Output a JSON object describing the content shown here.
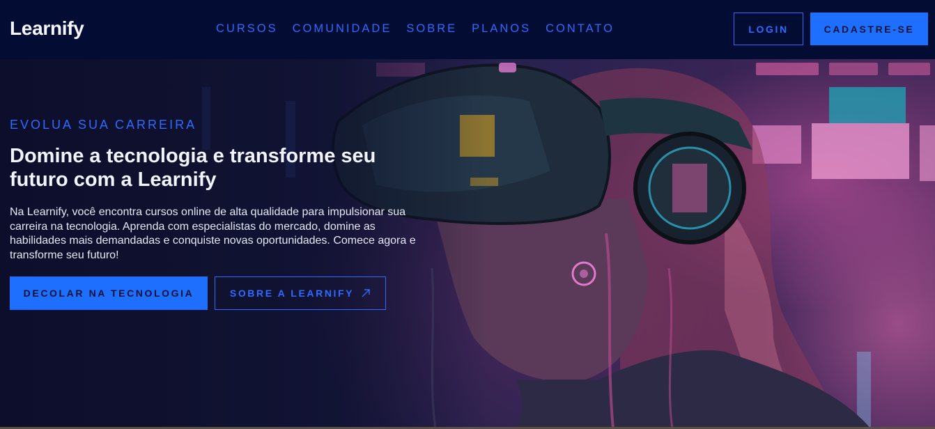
{
  "header": {
    "logo": "Learnify",
    "nav": [
      "CURSOS",
      "COMUNIDADE",
      "SOBRE",
      "PLANOS",
      "CONTATO"
    ],
    "login_label": "LOGIN",
    "signup_label": "CADASTRE-SE"
  },
  "hero": {
    "eyebrow": "EVOLUA SUA CARREIRA",
    "headline": "Domine a tecnologia e transforme seu futuro com a Learnify",
    "description": "Na Learnify, você encontra cursos online de alta qualidade para impulsionar sua carreira na tecnologia. Aprenda com especialistas do mercado, domine as habilidades mais demandadas e conquiste novas oportunidades. Comece agora e transforme seu futuro!",
    "primary_cta": "DECOLAR NA TECNOLOGIA",
    "secondary_cta": "SOBRE A LEARNIFY",
    "secondary_cta_icon": "arrow-up-right-icon",
    "background_image": "cyberpunk-vr-headset-illustration"
  },
  "colors": {
    "header_bg": "#030c33",
    "accent": "#1f6fff",
    "accent_text": "#2f6bff",
    "heading_text": "#f2f4ff"
  }
}
